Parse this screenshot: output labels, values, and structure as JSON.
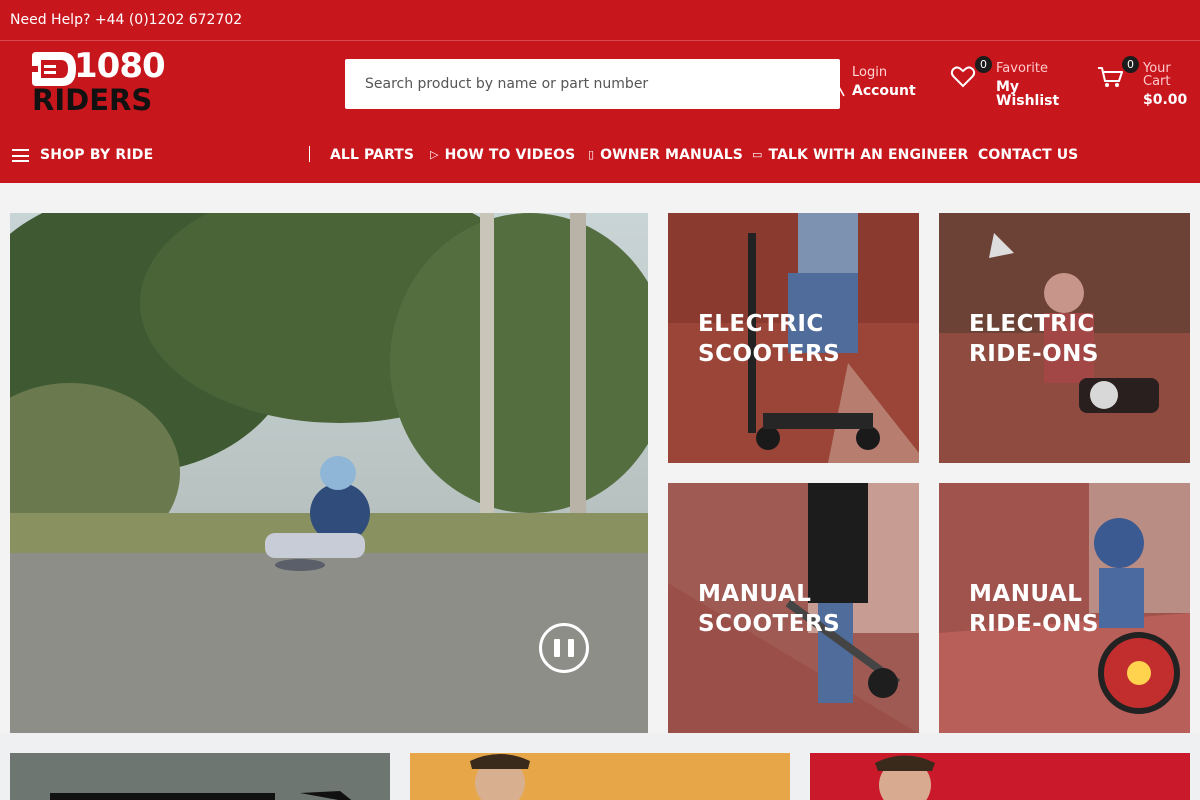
{
  "topbar": {
    "help_text": "Need Help? +44 (0)1202 672702"
  },
  "brand": {
    "name_line1": "1080",
    "name_line2": "RIDERS",
    "primary_color": "#c8161d"
  },
  "search": {
    "placeholder": "Search product by name or part number",
    "value": ""
  },
  "account": {
    "small_label": "Login",
    "label": "Account"
  },
  "wishlist": {
    "count": "0",
    "small_label": "Favorite",
    "label_line1": "My",
    "label_line2": "Wishlist"
  },
  "cart": {
    "count": "0",
    "small_label_line1": "Your",
    "small_label_line2": "Cart",
    "total": "$0.00"
  },
  "nav": {
    "shop_by_ride": "SHOP BY RIDE",
    "items": [
      {
        "label": "ALL PARTS",
        "icon": ""
      },
      {
        "label": "HOW TO VIDEOS",
        "icon": "play-icon"
      },
      {
        "label": "OWNER MANUALS",
        "icon": "document-icon"
      },
      {
        "label": "TALK WITH AN ENGINEER",
        "icon": "chat-icon"
      },
      {
        "label": "CONTACT US",
        "icon": ""
      }
    ]
  },
  "hero": {
    "video_state": "playing"
  },
  "categories": [
    {
      "line1": "ELECTRIC",
      "line2": "SCOOTERS"
    },
    {
      "line1": "ELECTRIC",
      "line2": "RIDE-ONS"
    },
    {
      "line1": "MANUAL",
      "line2": "SCOOTERS"
    },
    {
      "line1": "MANUAL",
      "line2": "RIDE-ONS"
    }
  ]
}
